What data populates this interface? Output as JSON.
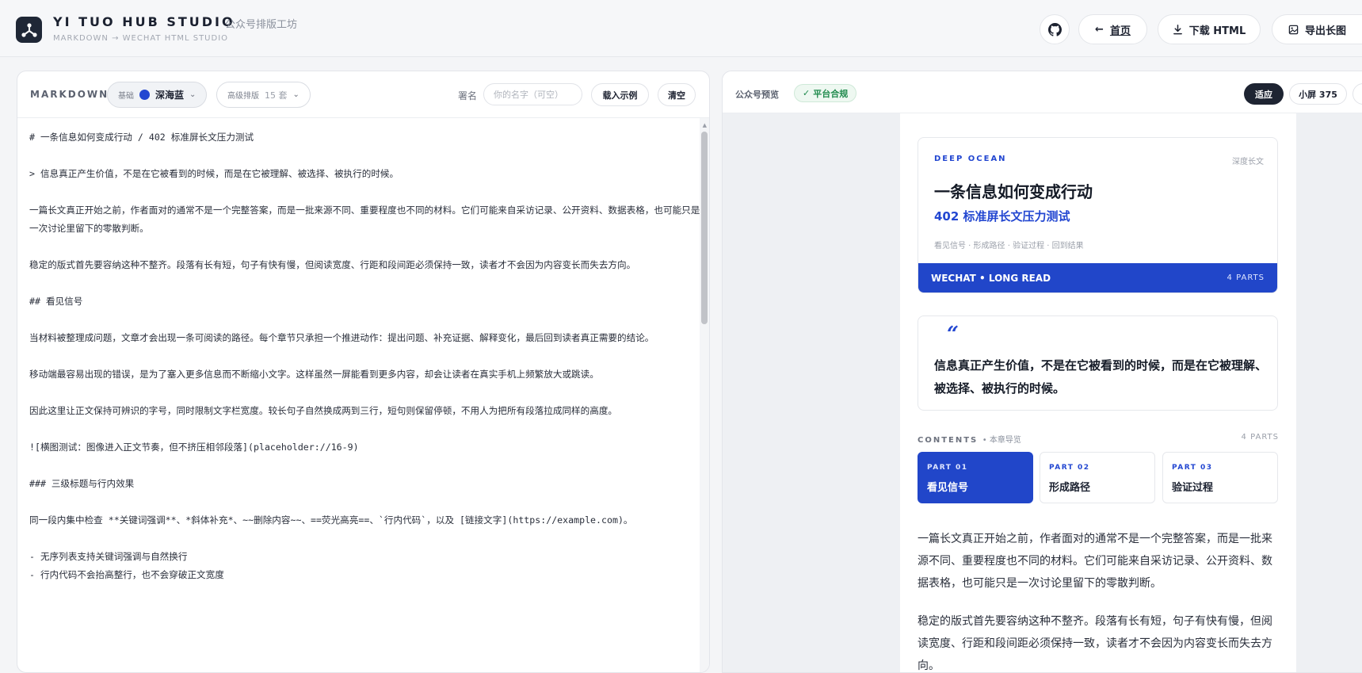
{
  "header": {
    "brand_title": "YI TUO HUB STUDIO",
    "brand_subtitle": "公众号排版工坊",
    "tagline": "MARKDOWN → WECHAT HTML STUDIO",
    "home_label": "首页",
    "download_label": "下载 HTML",
    "export_label": "导出长图"
  },
  "editor": {
    "label": "MARKDOWN",
    "theme_group": "基础",
    "theme_name": "深海蓝",
    "theme_color": "#2347d1",
    "advanced_label": "高级排版",
    "advanced_count": "15 套",
    "sign_label": "署名",
    "sign_placeholder": "你的名字（可空）",
    "load_example_label": "载入示例",
    "clear_label": "清空",
    "lines": [
      "# 一条信息如何变成行动 / 402 标准屏长文压力测试",
      "",
      "> 信息真正产生价值，不是在它被看到的时候，而是在它被理解、被选择、被执行的时候。",
      "",
      "一篇长文真正开始之前，作者面对的通常不是一个完整答案，而是一批来源不同、重要程度也不同的材料。它们可能来自采访记录、公开资料、数据表格，也可能只是一次讨论里留下的零散判断。",
      "",
      "稳定的版式首先要容纳这种不整齐。段落有长有短，句子有快有慢，但阅读宽度、行距和段间距必须保持一致，读者才不会因为内容变长而失去方向。",
      "",
      "## 看见信号",
      "",
      "当材料被整理成问题，文章才会出现一条可阅读的路径。每个章节只承担一个推进动作：提出问题、补充证据、解释变化，最后回到读者真正需要的结论。",
      "",
      "移动端最容易出现的错误，是为了塞入更多信息而不断缩小文字。这样虽然一屏能看到更多内容，却会让读者在真实手机上频繁放大或跳读。",
      "",
      "因此这里让正文保持可辨识的字号，同时限制文字栏宽度。较长句子自然换成两到三行，短句则保留停顿，不用人为把所有段落拉成同样的高度。",
      "",
      "![横图测试：图像进入正文节奏，但不挤压相邻段落](placeholder://16-9)",
      "",
      "### 三级标题与行内效果",
      "",
      "同一段内集中检查 **关键词强调**、*斜体补充*、~~删除内容~~、==荧光高亮==、`行内代码`，以及 [链接文字](https://example.com)。",
      "",
      "- 无序列表支持关键词强调与自然换行",
      "- 行内代码不会抬高整行，也不会穿破正文宽度"
    ]
  },
  "preview": {
    "label": "公众号预览",
    "compliance_badge": "平台合规",
    "fit_label": "适应",
    "small_label": "小屏 375",
    "accent_color": "#2146c9",
    "card": {
      "kicker": "DEEP OCEAN",
      "tag": "深度长文",
      "title": "一条信息如何变成行动",
      "subtitle": "402 标准屏长文压力测试",
      "steps": "看见信号 · 形成路径 · 验证过程 · 回到结果",
      "bar_left": "WECHAT • LONG READ",
      "bar_right": "4 PARTS"
    },
    "quote": {
      "mark": "“",
      "text": "信息真正产生价值，不是在它被看到的时候，而是在它被理解、被选择、被执行的时候。"
    },
    "toc": {
      "heading": "CONTENTS",
      "heading_sub": "本章导览",
      "count": "4 PARTS",
      "items": [
        {
          "part": "PART 01",
          "name": "看见信号"
        },
        {
          "part": "PART 02",
          "name": "形成路径"
        },
        {
          "part": "PART 03",
          "name": "验证过程"
        }
      ]
    },
    "paragraphs": [
      "一篇长文真正开始之前，作者面对的通常不是一个完整答案，而是一批来源不同、重要程度也不同的材料。它们可能来自采访记录、公开资料、数据表格，也可能只是一次讨论里留下的零散判断。",
      "稳定的版式首先要容纳这种不整齐。段落有长有短，句子有快有慢，但阅读宽度、行距和段间距必须保持一致，读者才不会因为内容变长而失去方向。"
    ]
  }
}
